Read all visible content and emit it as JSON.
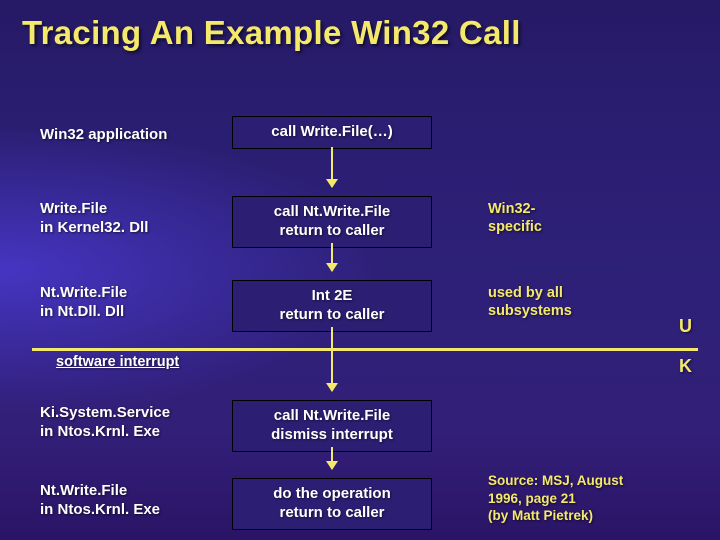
{
  "title": "Tracing An Example Win32 Call",
  "left_labels": {
    "l1": "Win32 application",
    "l2a": "Write.File",
    "l2b": "in Kernel32. Dll",
    "l3a": "Nt.Write.File",
    "l3b": "in Nt.Dll. Dll",
    "l4": "software interrupt",
    "l5a": "Ki.System.Service",
    "l5b": "in Ntos.Krnl. Exe",
    "l6a": "Nt.Write.File",
    "l6b": "in Ntos.Krnl. Exe"
  },
  "boxes": {
    "b1": "call Write.File(…)",
    "b2a": "call Nt.Write.File",
    "b2b": "return to caller",
    "b3a": "Int 2E",
    "b3b": "return to caller",
    "b4a": "call Nt.Write.File",
    "b4b": "dismiss interrupt",
    "b5a": "do the operation",
    "b5b": "return to caller"
  },
  "notes": {
    "n1a": "Win32-",
    "n1b": "specific",
    "n2a": "used by all",
    "n2b": "subsystems"
  },
  "uk": {
    "u": "U",
    "k": "K"
  },
  "source": {
    "l1": "Source: MSJ, August",
    "l2": "1996, page 21",
    "l3": "(by Matt Pietrek)"
  }
}
